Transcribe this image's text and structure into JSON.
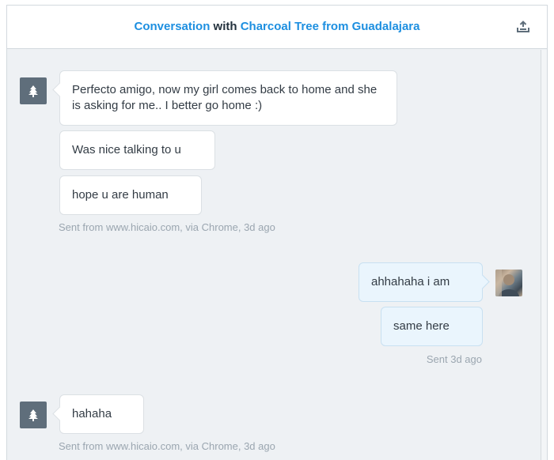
{
  "header": {
    "title_part1": "Conversation",
    "title_part2": "with",
    "title_part3": "Charcoal Tree from Guadalajara",
    "export_icon": "export-upload-icon",
    "link_color": "#1d8fe0"
  },
  "messages": [
    {
      "sender": "visitor",
      "bubbles": [
        "Perfecto amigo, now my girl comes back to home and she is asking for me.. I better go home :)",
        "Was nice talking to u",
        "hope u are human"
      ],
      "meta": "Sent from www.hicaio.com, via Chrome, 3d ago"
    },
    {
      "sender": "agent",
      "bubbles": [
        "ahhahaha i am",
        "same here"
      ],
      "meta": "Sent 3d ago"
    },
    {
      "sender": "visitor",
      "bubbles": [
        "hahaha"
      ],
      "meta": "Sent from www.hicaio.com, via Chrome, 3d ago"
    }
  ],
  "icons": {
    "visitor_avatar": "tree-icon",
    "agent_avatar": "user-photo"
  },
  "colors": {
    "background": "#eef1f4",
    "visitor_bubble": "#ffffff",
    "agent_bubble": "#eaf5fd",
    "visitor_avatar_bg": "#5f6e7b"
  }
}
